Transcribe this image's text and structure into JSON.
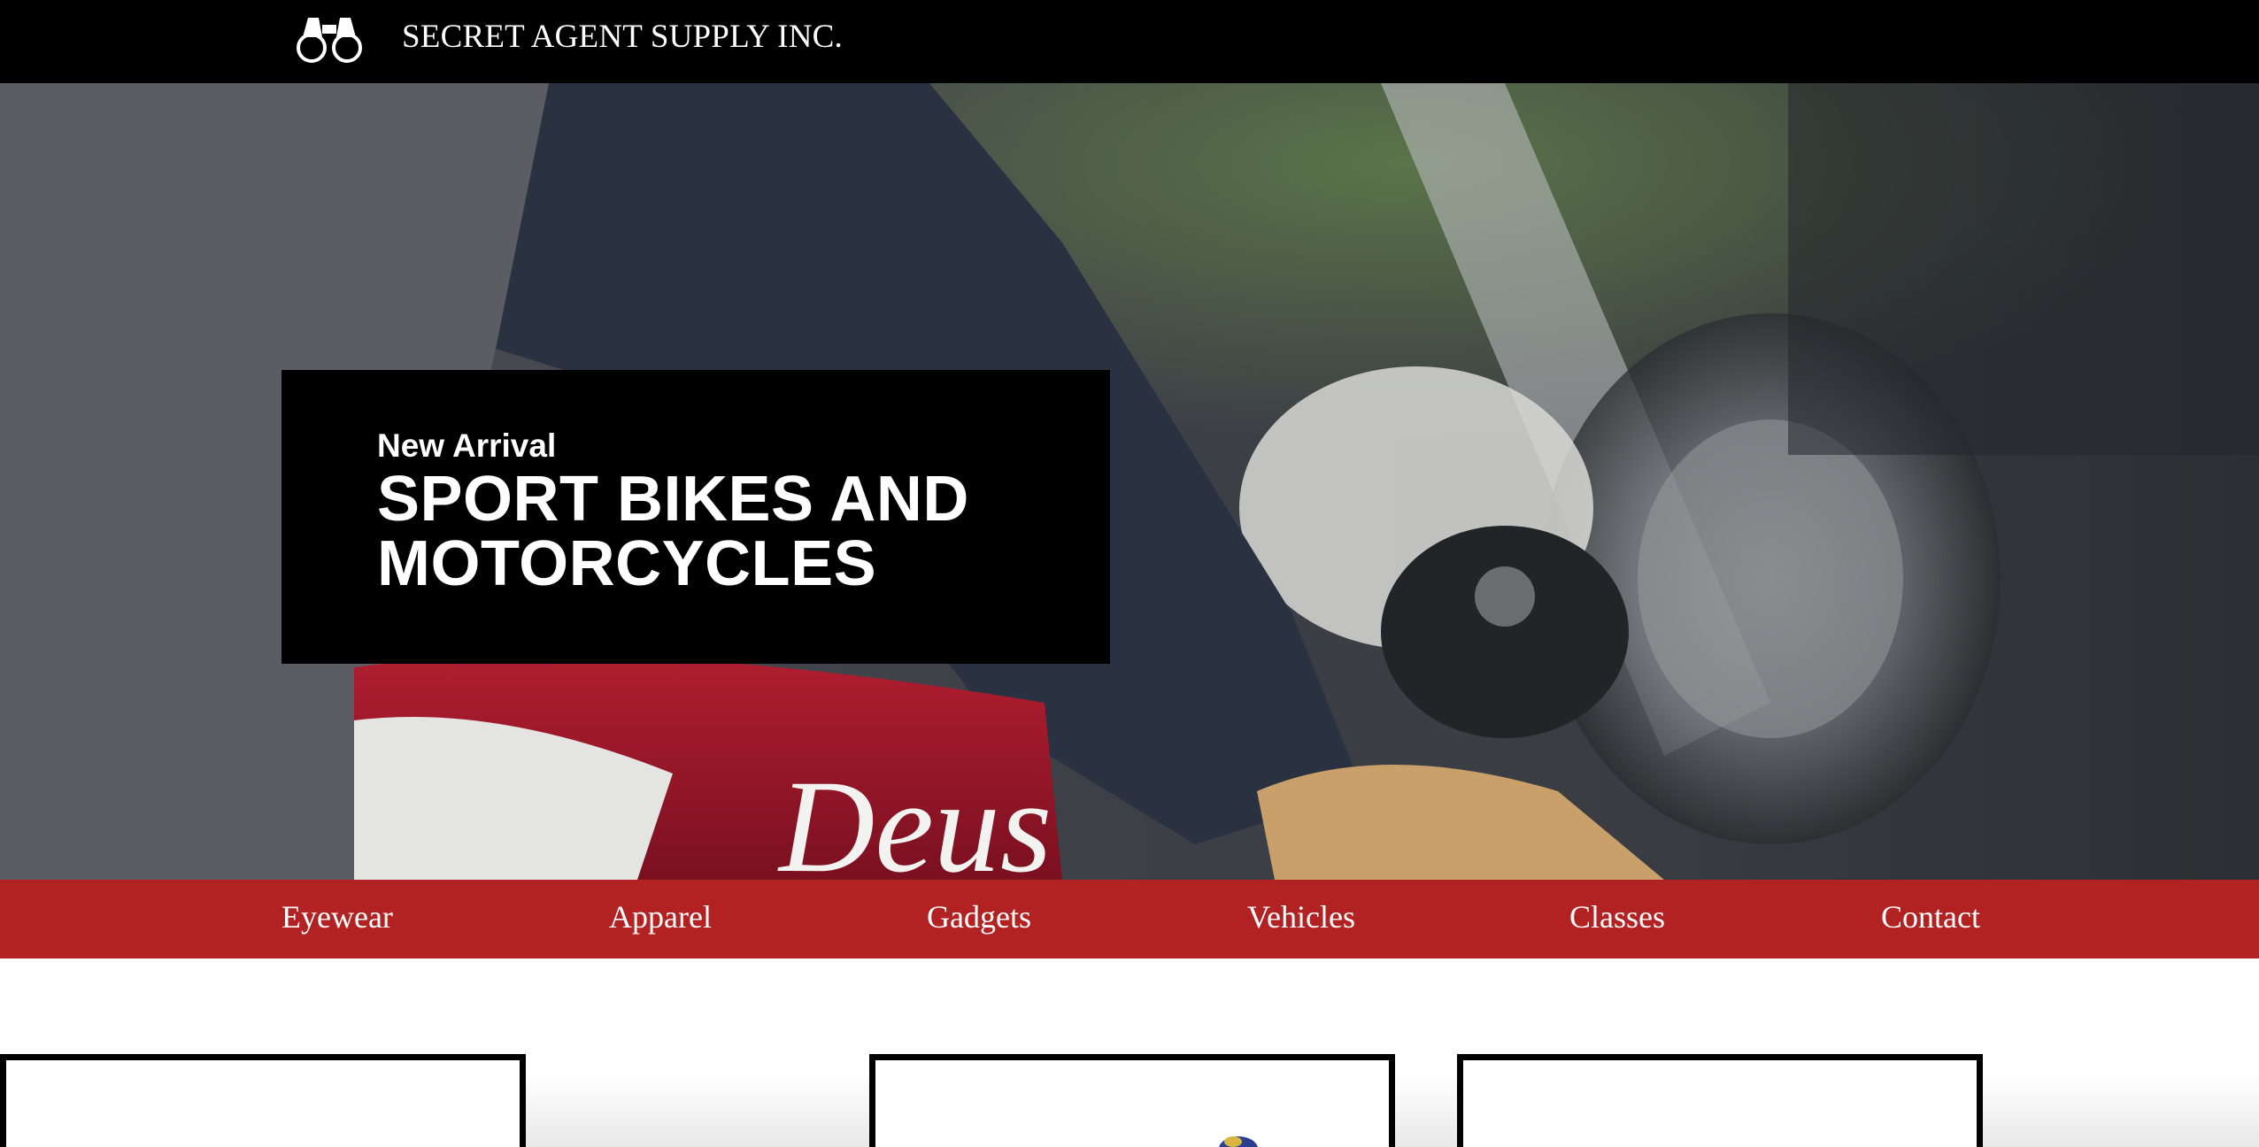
{
  "header": {
    "brand": "SECRET AGENT SUPPLY INC.",
    "logo_icon": "binoculars-icon",
    "background": "#000000"
  },
  "hero": {
    "eyebrow": "New Arrival",
    "title": "SPORT BIKES AND MOTORCYCLES",
    "background_image": "rider-on-motorcycle-photo"
  },
  "nav": {
    "background": "#b22222",
    "items": [
      {
        "label": "Eyewear"
      },
      {
        "label": "Apparel"
      },
      {
        "label": "Gadgets"
      },
      {
        "label": "Vehicles"
      },
      {
        "label": "Classes"
      },
      {
        "label": "Contact"
      }
    ]
  },
  "products": {
    "cards": [
      {
        "image": "product-eyewear-thumbnail"
      },
      {
        "image": "product-gadget-thumbnail"
      },
      {
        "image": "product-blank-thumbnail"
      }
    ]
  }
}
